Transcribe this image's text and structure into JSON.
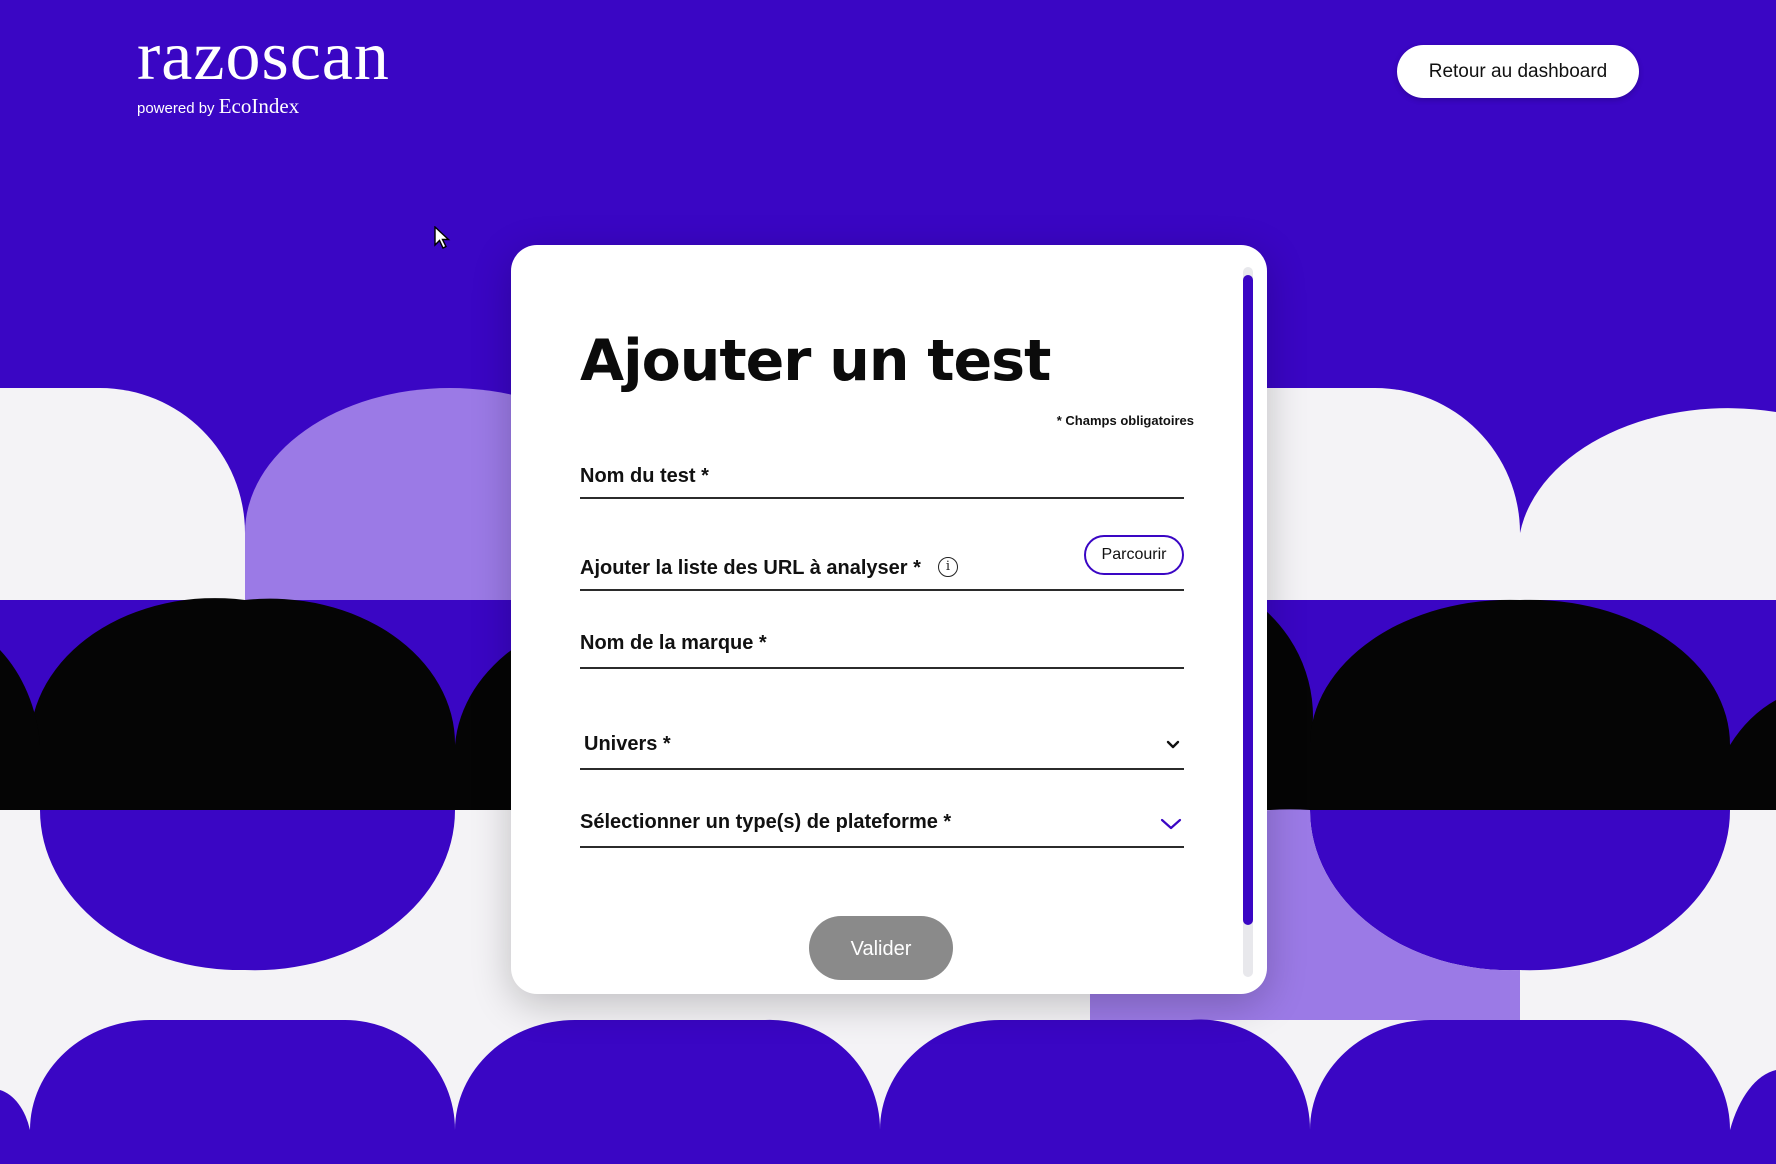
{
  "header": {
    "logo_text": "razoscan",
    "logo_powered_by": "powered by",
    "logo_brand": "EcoIndex",
    "dashboard_button": "Retour au dashboard"
  },
  "form": {
    "title": "Ajouter un test",
    "required_note": "* Champs obligatoires",
    "test_name_label": "Nom du test *",
    "url_list_label": "Ajouter la liste des URL à analyser *",
    "url_info_icon": "i",
    "browse_button": "Parcourir",
    "brand_label": "Nom de la marque *",
    "universe_label": "Univers *",
    "platform_label": "Sélectionner un type(s) de plateforme *",
    "submit_button": "Valider"
  },
  "colors": {
    "accent": "#3a06c4",
    "lavender": "#9b7ae6",
    "black": "#050505",
    "white": "#ffffff",
    "submit_disabled": "#8a8a8a"
  },
  "icons": {
    "info": "info-icon",
    "universe_dropdown": "chevron-down-icon",
    "platform_dropdown": "chevron-down-icon",
    "cursor": "mouse-pointer-icon"
  }
}
